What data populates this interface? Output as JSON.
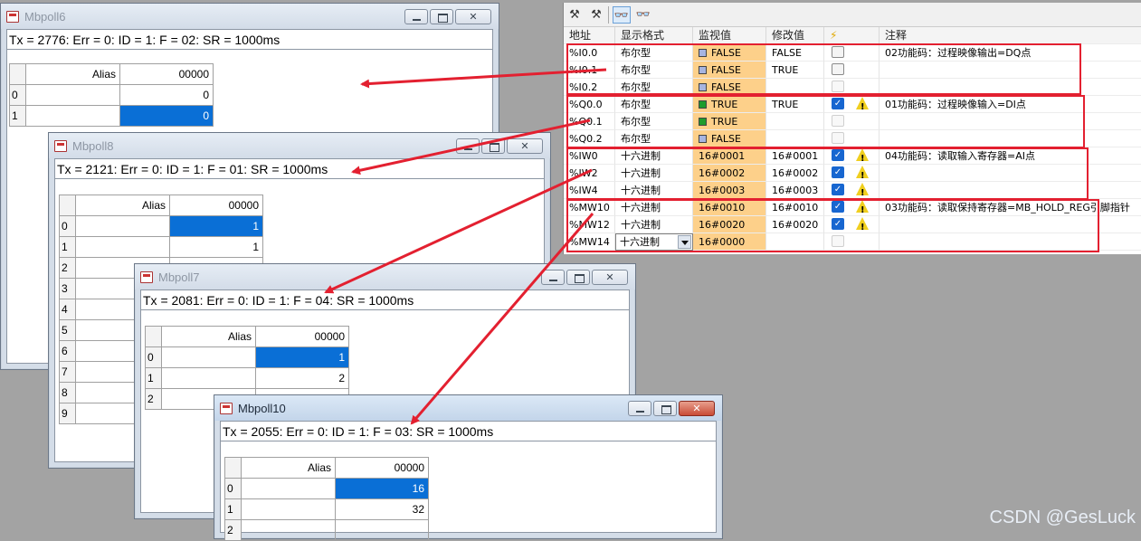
{
  "windows": {
    "w6": {
      "title": "Mbpoll6",
      "status": "Tx = 2776: Err = 0: ID = 1: F = 02: SR = 1000ms",
      "alias_header": "Alias",
      "col_header": "00000",
      "rows": [
        {
          "n": "0",
          "v": "0"
        },
        {
          "n": "1",
          "v": "0"
        }
      ]
    },
    "w8": {
      "title": "Mbpoll8",
      "status": "Tx = 2121: Err = 0: ID = 1: F = 01: SR = 1000ms",
      "alias_header": "Alias",
      "col_header": "00000",
      "rows": [
        {
          "n": "0",
          "v": "1"
        },
        {
          "n": "1",
          "v": "1"
        },
        {
          "n": "2",
          "v": ""
        },
        {
          "n": "3",
          "v": ""
        },
        {
          "n": "4",
          "v": ""
        },
        {
          "n": "5",
          "v": ""
        },
        {
          "n": "6",
          "v": ""
        },
        {
          "n": "7",
          "v": ""
        },
        {
          "n": "8",
          "v": ""
        },
        {
          "n": "9",
          "v": ""
        }
      ]
    },
    "w7": {
      "title": "Mbpoll7",
      "status": "Tx = 2081: Err = 0: ID = 1: F = 04: SR = 1000ms",
      "alias_header": "Alias",
      "col_header": "00000",
      "rows": [
        {
          "n": "0",
          "v": "1"
        },
        {
          "n": "1",
          "v": "2"
        },
        {
          "n": "2",
          "v": ""
        }
      ]
    },
    "w10": {
      "title": "Mbpoll10",
      "status": "Tx = 2055: Err = 0: ID = 1: F = 03: SR = 1000ms",
      "alias_header": "Alias",
      "col_header": "00000",
      "rows": [
        {
          "n": "0",
          "v": "16"
        },
        {
          "n": "1",
          "v": "32"
        },
        {
          "n": "2",
          "v": ""
        }
      ]
    }
  },
  "watch": {
    "toolbar_icons": [
      "modify-now-icon",
      "modify-trigger-icon",
      "monitor-all-icon",
      "monitor-once-icon"
    ],
    "headers": {
      "address": "地址",
      "format": "显示格式",
      "monitor": "监视值",
      "modify": "修改值",
      "force": "⚡",
      "comment": "注释"
    },
    "rows": [
      {
        "addr": "%I0.0",
        "fmt": "布尔型",
        "mon": "FALSE",
        "swatch": "false",
        "mod": "FALSE",
        "check": "off",
        "warn": false,
        "comment": "02功能码：过程映像输出=DQ点"
      },
      {
        "addr": "%I0.1",
        "fmt": "布尔型",
        "mon": "FALSE",
        "swatch": "false",
        "mod": "TRUE",
        "check": "off",
        "warn": false,
        "comment": ""
      },
      {
        "addr": "%I0.2",
        "fmt": "布尔型",
        "mon": "FALSE",
        "swatch": "false",
        "mod": "",
        "check": "dis",
        "warn": false,
        "comment": ""
      },
      {
        "addr": "%Q0.0",
        "fmt": "布尔型",
        "mon": "TRUE",
        "swatch": "true",
        "mod": "TRUE",
        "check": "on",
        "warn": true,
        "comment": "01功能码：过程映像输入=DI点"
      },
      {
        "addr": "%Q0.1",
        "fmt": "布尔型",
        "mon": "TRUE",
        "swatch": "true",
        "mod": "",
        "check": "dis",
        "warn": false,
        "comment": ""
      },
      {
        "addr": "%Q0.2",
        "fmt": "布尔型",
        "mon": "FALSE",
        "swatch": "false",
        "mod": "",
        "check": "dis",
        "warn": false,
        "comment": ""
      },
      {
        "addr": "%IW0",
        "fmt": "十六进制",
        "mon": "16#0001",
        "swatch": "",
        "mod": "16#0001",
        "check": "on",
        "warn": true,
        "comment": "04功能码：读取输入寄存器=AI点"
      },
      {
        "addr": "%IW2",
        "fmt": "十六进制",
        "mon": "16#0002",
        "swatch": "",
        "mod": "16#0002",
        "check": "on",
        "warn": true,
        "comment": ""
      },
      {
        "addr": "%IW4",
        "fmt": "十六进制",
        "mon": "16#0003",
        "swatch": "",
        "mod": "16#0003",
        "check": "on",
        "warn": true,
        "comment": ""
      },
      {
        "addr": "%MW10",
        "fmt": "十六进制",
        "mon": "16#0010",
        "swatch": "",
        "mod": "16#0010",
        "check": "on",
        "warn": true,
        "comment": "03功能码：读取保持寄存器=MB_HOLD_REG引脚指针"
      },
      {
        "addr": "%MW12",
        "fmt": "十六进制",
        "mon": "16#0020",
        "swatch": "",
        "mod": "16#0020",
        "check": "on",
        "warn": true,
        "comment": ""
      },
      {
        "addr": "%MW14",
        "fmt": "十六进制",
        "mon": "16#0000",
        "swatch": "",
        "mod": "",
        "check": "dis",
        "warn": false,
        "comment": "",
        "dropdown": true
      }
    ]
  },
  "watermark": "CSDN @GesLuck",
  "colors": {
    "highlight_row": "#0a6fd6",
    "monitor_cell": "#fdd08a",
    "annotation": "#e32030"
  }
}
